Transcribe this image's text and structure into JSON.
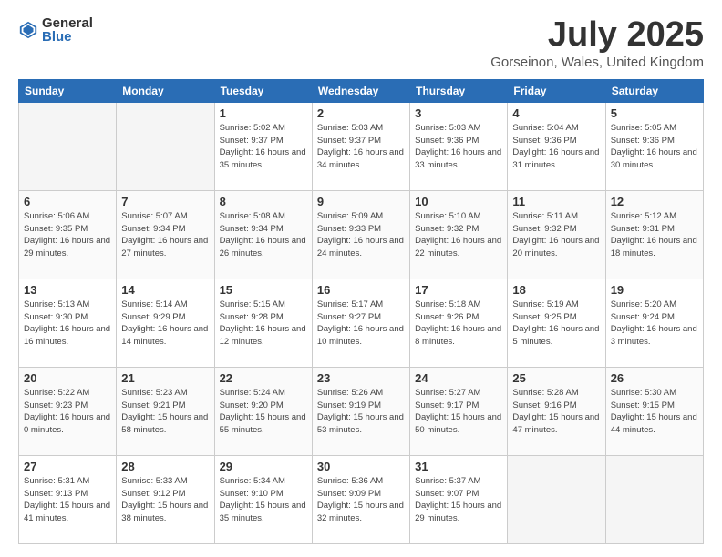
{
  "logo": {
    "general": "General",
    "blue": "Blue"
  },
  "title": "July 2025",
  "location": "Gorseinon, Wales, United Kingdom",
  "days_of_week": [
    "Sunday",
    "Monday",
    "Tuesday",
    "Wednesday",
    "Thursday",
    "Friday",
    "Saturday"
  ],
  "weeks": [
    [
      {
        "day": "",
        "info": ""
      },
      {
        "day": "",
        "info": ""
      },
      {
        "day": "1",
        "info": "Sunrise: 5:02 AM\nSunset: 9:37 PM\nDaylight: 16 hours and 35 minutes."
      },
      {
        "day": "2",
        "info": "Sunrise: 5:03 AM\nSunset: 9:37 PM\nDaylight: 16 hours and 34 minutes."
      },
      {
        "day": "3",
        "info": "Sunrise: 5:03 AM\nSunset: 9:36 PM\nDaylight: 16 hours and 33 minutes."
      },
      {
        "day": "4",
        "info": "Sunrise: 5:04 AM\nSunset: 9:36 PM\nDaylight: 16 hours and 31 minutes."
      },
      {
        "day": "5",
        "info": "Sunrise: 5:05 AM\nSunset: 9:36 PM\nDaylight: 16 hours and 30 minutes."
      }
    ],
    [
      {
        "day": "6",
        "info": "Sunrise: 5:06 AM\nSunset: 9:35 PM\nDaylight: 16 hours and 29 minutes."
      },
      {
        "day": "7",
        "info": "Sunrise: 5:07 AM\nSunset: 9:34 PM\nDaylight: 16 hours and 27 minutes."
      },
      {
        "day": "8",
        "info": "Sunrise: 5:08 AM\nSunset: 9:34 PM\nDaylight: 16 hours and 26 minutes."
      },
      {
        "day": "9",
        "info": "Sunrise: 5:09 AM\nSunset: 9:33 PM\nDaylight: 16 hours and 24 minutes."
      },
      {
        "day": "10",
        "info": "Sunrise: 5:10 AM\nSunset: 9:32 PM\nDaylight: 16 hours and 22 minutes."
      },
      {
        "day": "11",
        "info": "Sunrise: 5:11 AM\nSunset: 9:32 PM\nDaylight: 16 hours and 20 minutes."
      },
      {
        "day": "12",
        "info": "Sunrise: 5:12 AM\nSunset: 9:31 PM\nDaylight: 16 hours and 18 minutes."
      }
    ],
    [
      {
        "day": "13",
        "info": "Sunrise: 5:13 AM\nSunset: 9:30 PM\nDaylight: 16 hours and 16 minutes."
      },
      {
        "day": "14",
        "info": "Sunrise: 5:14 AM\nSunset: 9:29 PM\nDaylight: 16 hours and 14 minutes."
      },
      {
        "day": "15",
        "info": "Sunrise: 5:15 AM\nSunset: 9:28 PM\nDaylight: 16 hours and 12 minutes."
      },
      {
        "day": "16",
        "info": "Sunrise: 5:17 AM\nSunset: 9:27 PM\nDaylight: 16 hours and 10 minutes."
      },
      {
        "day": "17",
        "info": "Sunrise: 5:18 AM\nSunset: 9:26 PM\nDaylight: 16 hours and 8 minutes."
      },
      {
        "day": "18",
        "info": "Sunrise: 5:19 AM\nSunset: 9:25 PM\nDaylight: 16 hours and 5 minutes."
      },
      {
        "day": "19",
        "info": "Sunrise: 5:20 AM\nSunset: 9:24 PM\nDaylight: 16 hours and 3 minutes."
      }
    ],
    [
      {
        "day": "20",
        "info": "Sunrise: 5:22 AM\nSunset: 9:23 PM\nDaylight: 16 hours and 0 minutes."
      },
      {
        "day": "21",
        "info": "Sunrise: 5:23 AM\nSunset: 9:21 PM\nDaylight: 15 hours and 58 minutes."
      },
      {
        "day": "22",
        "info": "Sunrise: 5:24 AM\nSunset: 9:20 PM\nDaylight: 15 hours and 55 minutes."
      },
      {
        "day": "23",
        "info": "Sunrise: 5:26 AM\nSunset: 9:19 PM\nDaylight: 15 hours and 53 minutes."
      },
      {
        "day": "24",
        "info": "Sunrise: 5:27 AM\nSunset: 9:17 PM\nDaylight: 15 hours and 50 minutes."
      },
      {
        "day": "25",
        "info": "Sunrise: 5:28 AM\nSunset: 9:16 PM\nDaylight: 15 hours and 47 minutes."
      },
      {
        "day": "26",
        "info": "Sunrise: 5:30 AM\nSunset: 9:15 PM\nDaylight: 15 hours and 44 minutes."
      }
    ],
    [
      {
        "day": "27",
        "info": "Sunrise: 5:31 AM\nSunset: 9:13 PM\nDaylight: 15 hours and 41 minutes."
      },
      {
        "day": "28",
        "info": "Sunrise: 5:33 AM\nSunset: 9:12 PM\nDaylight: 15 hours and 38 minutes."
      },
      {
        "day": "29",
        "info": "Sunrise: 5:34 AM\nSunset: 9:10 PM\nDaylight: 15 hours and 35 minutes."
      },
      {
        "day": "30",
        "info": "Sunrise: 5:36 AM\nSunset: 9:09 PM\nDaylight: 15 hours and 32 minutes."
      },
      {
        "day": "31",
        "info": "Sunrise: 5:37 AM\nSunset: 9:07 PM\nDaylight: 15 hours and 29 minutes."
      },
      {
        "day": "",
        "info": ""
      },
      {
        "day": "",
        "info": ""
      }
    ]
  ]
}
